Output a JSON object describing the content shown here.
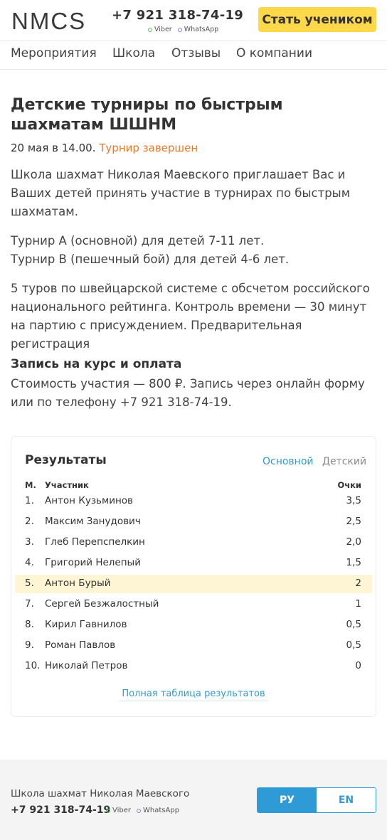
{
  "header": {
    "logo": "NMCS",
    "phone": "+7 921 318-74-19",
    "viber": "Viber",
    "whatsapp": "WhatsApp",
    "cta": "Стать учеником"
  },
  "nav": [
    "Мероприятия",
    "Школа",
    "Отзывы",
    "О компании"
  ],
  "article": {
    "title": "Детские турниры по быстрым шахматам ШШНМ",
    "date": "20 мая в 14.00.",
    "status": "Турнир завершен",
    "p1": "Школа шахмат Николая Маевского приглашает Вас и Ваших детей принять участие в турнирах по быстрым шахматам.",
    "p2a": "Турнир А (основной) для детей 7-11 лет.",
    "p2b": "Турнир В (пешечный бой) для детей 4-6 лет.",
    "p3": "5 туров по швейцарской системе с обсчетом российского национального рейтинга. Контроль времени — 30 минут на партию с присуждением. Предварительная регистрация",
    "subhead": "Запись на курс и оплата",
    "p4": "Стоимость участия — 800 ₽. Запись через онлайн форму или по телефону +7 921 318-74-19."
  },
  "results": {
    "title": "Результаты",
    "tabs": [
      "Основной",
      "Детский"
    ],
    "active_tab": "Основной",
    "col_place": "М.",
    "col_name": "Участник",
    "col_points": "Очки",
    "rows": [
      {
        "place": "1.",
        "name": "Антон Кузьминов",
        "points": "3,5",
        "highlighted": false
      },
      {
        "place": "2.",
        "name": "Максим Занудович",
        "points": "2,5",
        "highlighted": false
      },
      {
        "place": "3.",
        "name": "Глеб Перепспелкин",
        "points": "2,0",
        "highlighted": false
      },
      {
        "place": "4.",
        "name": "Григорий Нелепый",
        "points": "1,5",
        "highlighted": false
      },
      {
        "place": "5.",
        "name": "Антон Бурый",
        "points": "2",
        "highlighted": true
      },
      {
        "place": "7.",
        "name": "Сергей Безжалостный",
        "points": "1",
        "highlighted": false
      },
      {
        "place": "8.",
        "name": "Кирил Гавнилов",
        "points": "0,5",
        "highlighted": false
      },
      {
        "place": "9.",
        "name": "Роман Павлов",
        "points": "0,5",
        "highlighted": false
      },
      {
        "place": "10.",
        "name": "Николай Петров",
        "points": "0",
        "highlighted": false
      }
    ],
    "full_link": "Полная таблица результатов"
  },
  "footer": {
    "school": "Школа шахмат Николая Маевского",
    "phone": "+7 921 318-74-19",
    "viber": "Viber",
    "whatsapp": "WhatsApp",
    "lang_ru": "РУ",
    "lang_en": "EN",
    "active_lang": "РУ"
  },
  "colors": {
    "accent": "#2f9bd6",
    "cta": "#fdd84a",
    "status": "#e8792a",
    "highlight_row": "#fdf5d3",
    "viber_dot": "#5bbf60",
    "whatsapp_dot": "#8c7fd8"
  }
}
